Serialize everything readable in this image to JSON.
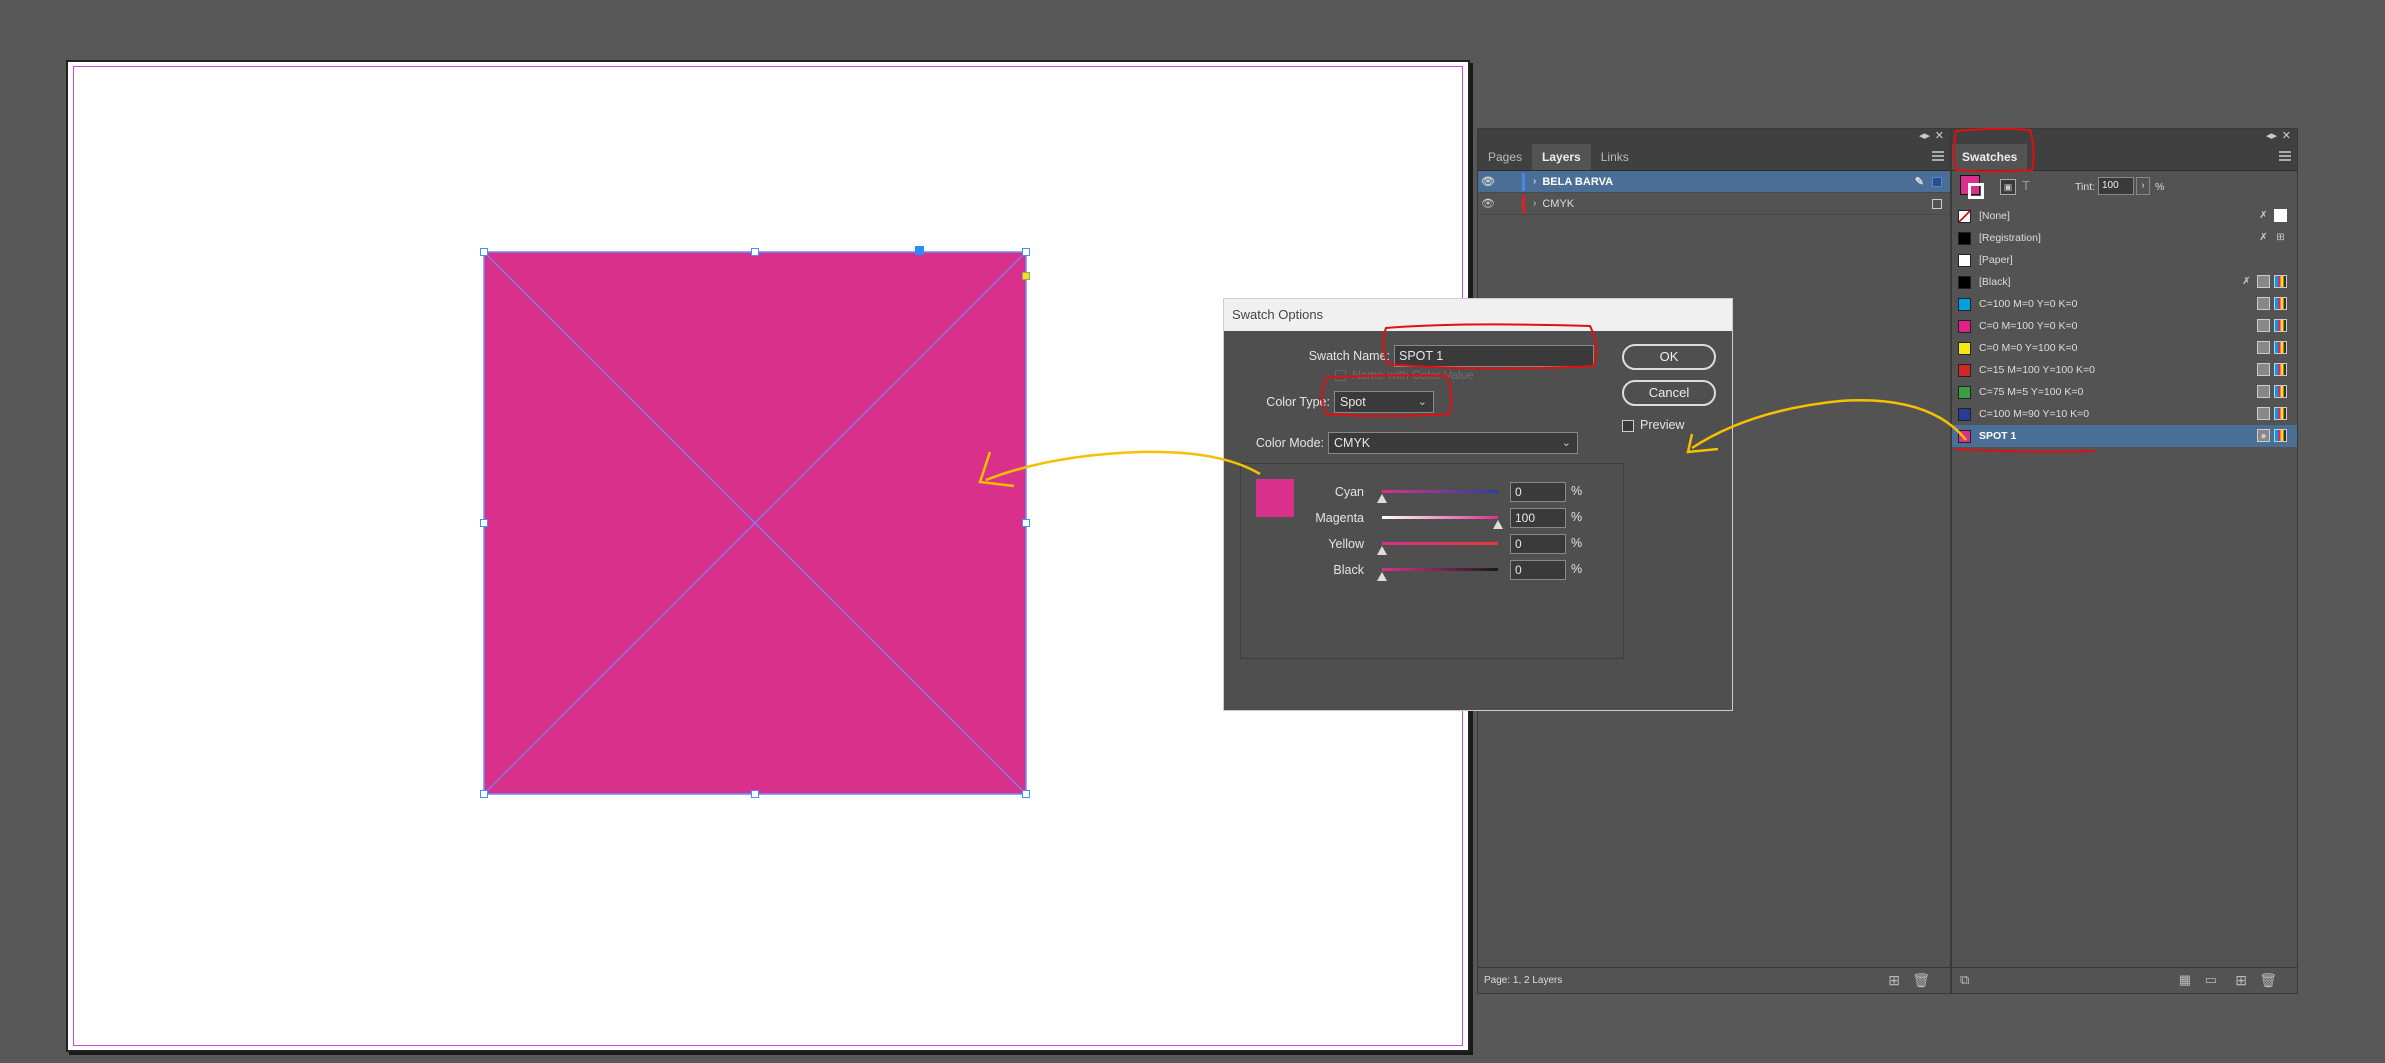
{
  "layers_panel": {
    "tabs": [
      "Pages",
      "Layers",
      "Links"
    ],
    "active_tab": "Layers",
    "layers": [
      {
        "name": "BELA BARVA",
        "selected": true,
        "color": "#4a86e8"
      },
      {
        "name": "CMYK",
        "selected": false,
        "color": "#e02020"
      }
    ],
    "footer_text": "Page: 1, 2 Layers"
  },
  "swatches_panel": {
    "tab": "Swatches",
    "tint_label": "Tint:",
    "tint_value": "100",
    "tint_unit": "%",
    "swatches": [
      {
        "name": "[None]",
        "color": "none"
      },
      {
        "name": "[Registration]",
        "color": "#000000"
      },
      {
        "name": "[Paper]",
        "color": "#ffffff"
      },
      {
        "name": "[Black]",
        "color": "#000000"
      },
      {
        "name": "C=100 M=0 Y=0 K=0",
        "color": "#00a0e0"
      },
      {
        "name": "C=0 M=100 Y=0 K=0",
        "color": "#e0208c"
      },
      {
        "name": "C=0 M=0 Y=100 K=0",
        "color": "#f8e810"
      },
      {
        "name": "C=15 M=100 Y=100 K=0",
        "color": "#d02828"
      },
      {
        "name": "C=75 M=5 Y=100 K=0",
        "color": "#38a040"
      },
      {
        "name": "C=100 M=90 Y=10 K=0",
        "color": "#283c94"
      },
      {
        "name": "SPOT 1",
        "color": "#d9318b",
        "selected": true
      }
    ]
  },
  "dialog": {
    "title": "Swatch Options",
    "swatch_name_label": "Swatch Name:",
    "swatch_name_value": "SPOT 1",
    "name_with_color_value_label": "Name with Color Value",
    "color_type_label": "Color Type:",
    "color_type_value": "Spot",
    "color_mode_label": "Color Mode:",
    "color_mode_value": "CMYK",
    "ok_label": "OK",
    "cancel_label": "Cancel",
    "preview_label": "Preview",
    "preview_checked": false,
    "pct": "%",
    "channels": [
      {
        "name": "Cyan",
        "value": "0",
        "fraction": 0.0,
        "gradient": "linear-gradient(90deg,#d9318b,#2b3fa8)"
      },
      {
        "name": "Magenta",
        "value": "100",
        "fraction": 1.0,
        "gradient": "linear-gradient(90deg,#ffffff,#d9318b)"
      },
      {
        "name": "Yellow",
        "value": "0",
        "fraction": 0.0,
        "gradient": "linear-gradient(90deg,#d9318b,#e33a3a)"
      },
      {
        "name": "Black",
        "value": "0",
        "fraction": 0.0,
        "gradient": "linear-gradient(90deg,#d9318b,#1a1a1a)"
      }
    ],
    "preview_color": "#d9318b"
  },
  "document": {
    "frame_fill": "#d9318b"
  },
  "annotations": {
    "red_highlight": "#e01010",
    "yellow_arrow": "#f5c000"
  }
}
